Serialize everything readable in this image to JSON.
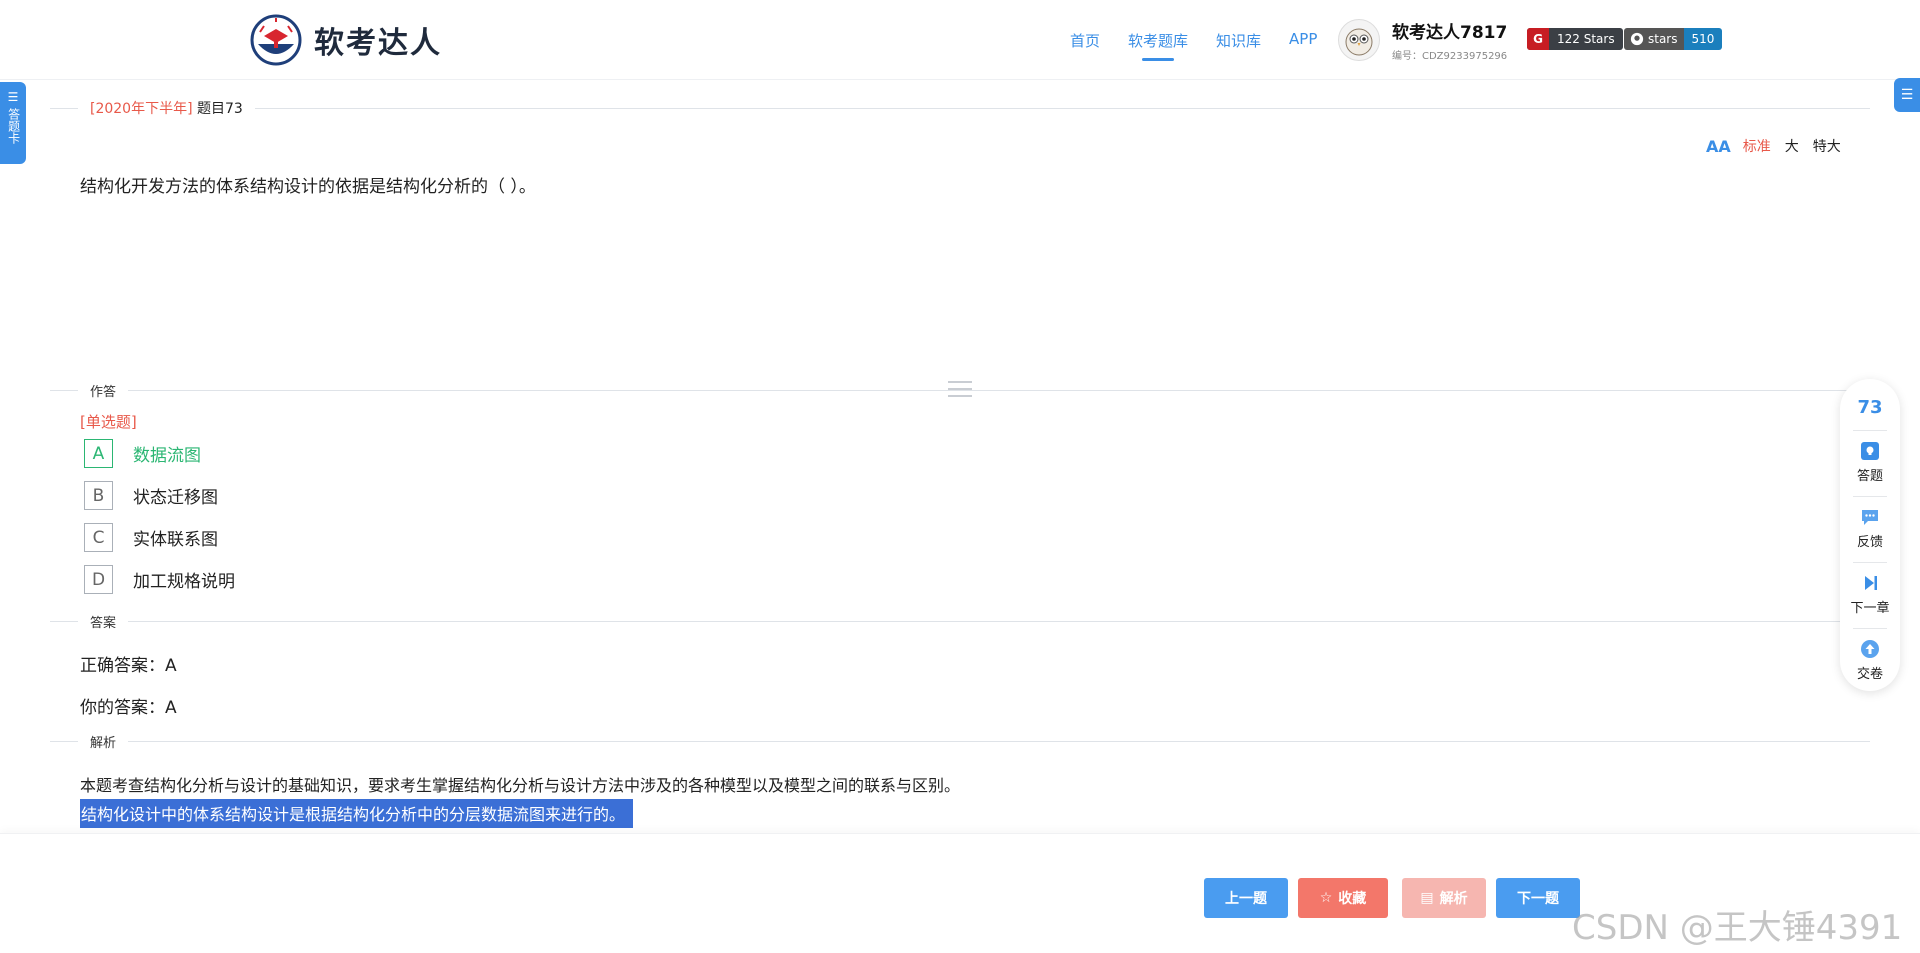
{
  "header": {
    "logo_text": "软考达人",
    "nav": [
      "首页",
      "软考题库",
      "知识库",
      "APP"
    ],
    "active_nav": "软考题库",
    "user": {
      "name": "软考达人7817",
      "id": "编号：CDZ9233975296"
    },
    "gitee_badge": "122 Stars",
    "github_badge": {
      "label": "stars",
      "count": "510"
    }
  },
  "side": {
    "answer_card_label": "答题卡"
  },
  "question": {
    "source_year": "[2020年下半年]",
    "number": "题目73",
    "font_sizes": [
      "标准",
      "大",
      "特大"
    ],
    "active_font_size": "标准",
    "text": "结构化开发方法的体系结构设计的依据是结构化分析的（ ）。"
  },
  "answer_section": {
    "label": "作答",
    "type": "[单选题]",
    "options": [
      {
        "letter": "A",
        "text": "数据流图",
        "correct": true
      },
      {
        "letter": "B",
        "text": "状态迁移图",
        "correct": false
      },
      {
        "letter": "C",
        "text": "实体联系图",
        "correct": false
      },
      {
        "letter": "D",
        "text": "加工规格说明",
        "correct": false
      }
    ]
  },
  "result_section": {
    "label": "答案",
    "correct_answer": "正确答案：A",
    "your_answer": "你的答案：A"
  },
  "analysis_section": {
    "label": "解析",
    "line1": "本题考查结构化分析与设计的基础知识，要求考生掌握结构化分析与设计方法中涉及的各种模型以及模型之间的联系与区别。",
    "line2": "结构化设计中的体系结构设计是根据结构化分析中的分层数据流图来进行的。"
  },
  "toolbar": {
    "question_number": "73",
    "items": [
      "答题",
      "反馈",
      "下一章",
      "交卷"
    ]
  },
  "bottom": {
    "prev": "上一题",
    "favorite": "收藏",
    "analysis": "解析",
    "next": "下一题"
  },
  "watermark": "CSDN @王大锤4391",
  "colors": {
    "primary": "#3a8ee6",
    "accent_red": "#e8594a",
    "correct_green": "#2bb673",
    "highlight": "#3b6fd6"
  }
}
